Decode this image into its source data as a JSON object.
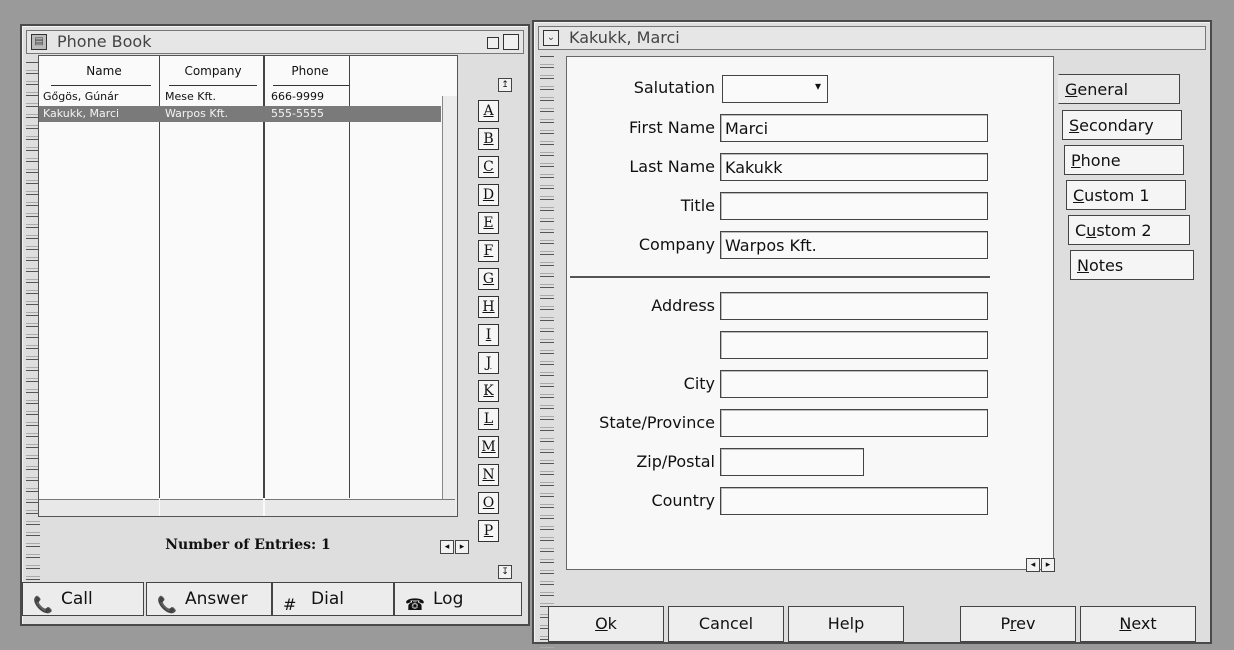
{
  "phonebook": {
    "title": "Phone Book",
    "columns": [
      "Name",
      "Company",
      "Phone"
    ],
    "rows": [
      {
        "name": "Gőgös, Gúnár",
        "company": "Mese Kft.",
        "phone": "666-9999"
      },
      {
        "name": "Kakukk, Marci",
        "company": "Warpos Kft.",
        "phone": "555-5555"
      }
    ],
    "entries": "Number of Entries: 1",
    "letters": [
      "A",
      "B",
      "C",
      "D",
      "E",
      "F",
      "G",
      "H",
      "I",
      "J",
      "K",
      "L",
      "M",
      "N",
      "O",
      "P"
    ],
    "actions": [
      {
        "label": "Call",
        "icon": "phone-handset-icon"
      },
      {
        "label": "Answer",
        "icon": "phone-handset-icon"
      },
      {
        "label": "Dial",
        "icon": "keypad-icon"
      },
      {
        "label": "Log",
        "icon": "log-icon"
      }
    ]
  },
  "detail": {
    "title": "Kakukk, Marci",
    "fields": {
      "salutation": {
        "label": "Salutation",
        "value": ""
      },
      "first_name": {
        "label": "First Name",
        "value": "Marci"
      },
      "last_name": {
        "label": "Last Name",
        "value": "Kakukk"
      },
      "title": {
        "label": "Title",
        "value": ""
      },
      "company": {
        "label": "Company",
        "value": "Warpos Kft."
      },
      "address": {
        "label": "Address",
        "value": "",
        "value2": ""
      },
      "city": {
        "label": "City",
        "value": ""
      },
      "state": {
        "label": "State/Province",
        "value": ""
      },
      "zip": {
        "label": "Zip/Postal",
        "value": ""
      },
      "country": {
        "label": "Country",
        "value": ""
      }
    },
    "tabs": [
      {
        "mnemonic": "G",
        "rest": "eneral"
      },
      {
        "mnemonic": "S",
        "rest": "econdary"
      },
      {
        "mnemonic": "P",
        "rest": "hone"
      },
      {
        "mnemonic": "C",
        "rest": "ustom 1"
      },
      {
        "pre": "C",
        "mnemonic": "u",
        "rest": "stom 2"
      },
      {
        "mnemonic": "N",
        "rest": "otes"
      }
    ],
    "buttons": {
      "ok": {
        "mnemonic": "O",
        "rest": "k"
      },
      "cancel": "Cancel",
      "help": "Help",
      "prev": {
        "pre": "P",
        "mnemonic": "r",
        "rest": "ev"
      },
      "next": {
        "mnemonic": "N",
        "rest": "ext"
      }
    }
  }
}
